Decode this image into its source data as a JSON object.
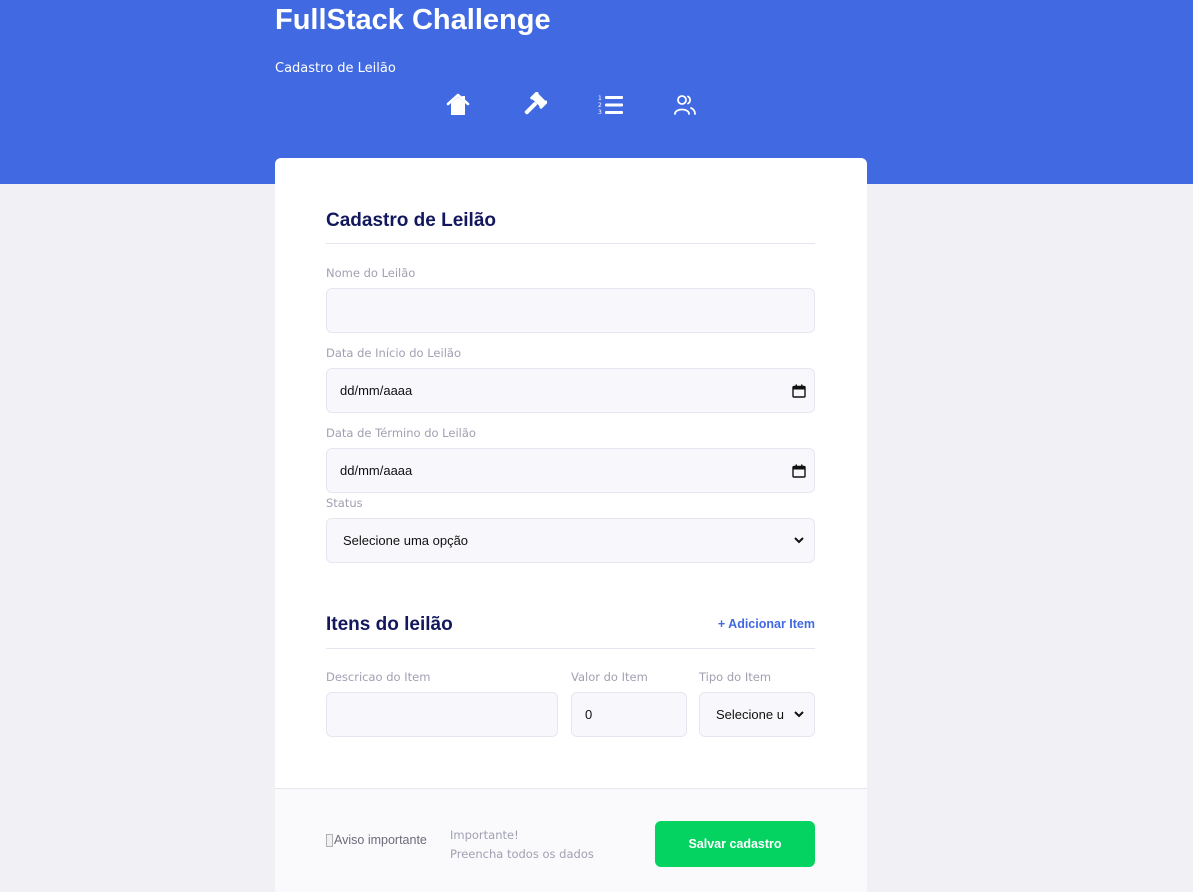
{
  "header": {
    "title": "FullStack Challenge",
    "subtitle": "Cadastro de Leilão",
    "nav": [
      {
        "icon": "home-icon",
        "label": "Home"
      },
      {
        "icon": "gavel-icon",
        "label": "Leilões"
      },
      {
        "icon": "ordered-list-icon",
        "label": "Lista"
      },
      {
        "icon": "users-icon",
        "label": "Usuários"
      }
    ],
    "background_color": "#4169e1"
  },
  "form": {
    "title": "Cadastro de Leilão",
    "nome": {
      "label": "Nome do Leilão",
      "value": ""
    },
    "data_inicio": {
      "label": "Data de Início do Leilão",
      "value": "dd/mm/aaaa"
    },
    "data_termino": {
      "label": "Data de Término do Leilão",
      "value": "dd/mm/aaaa"
    },
    "status": {
      "label": "Status",
      "selected": "Selecione uma opção"
    }
  },
  "items": {
    "title": "Itens do leilão",
    "add_label": "+ Adicionar Item",
    "descricao": {
      "label": "Descricao do Item",
      "value": ""
    },
    "valor": {
      "label": "Valor do Item",
      "value": "0"
    },
    "tipo": {
      "label": "Tipo do Item",
      "selected": "Selecione um"
    }
  },
  "footer": {
    "image_alt": "Aviso importante",
    "notice_title": "Importante!",
    "notice_text": "Preencha todos os dados",
    "save_label": "Salvar cadastro",
    "save_color": "#04d361"
  }
}
